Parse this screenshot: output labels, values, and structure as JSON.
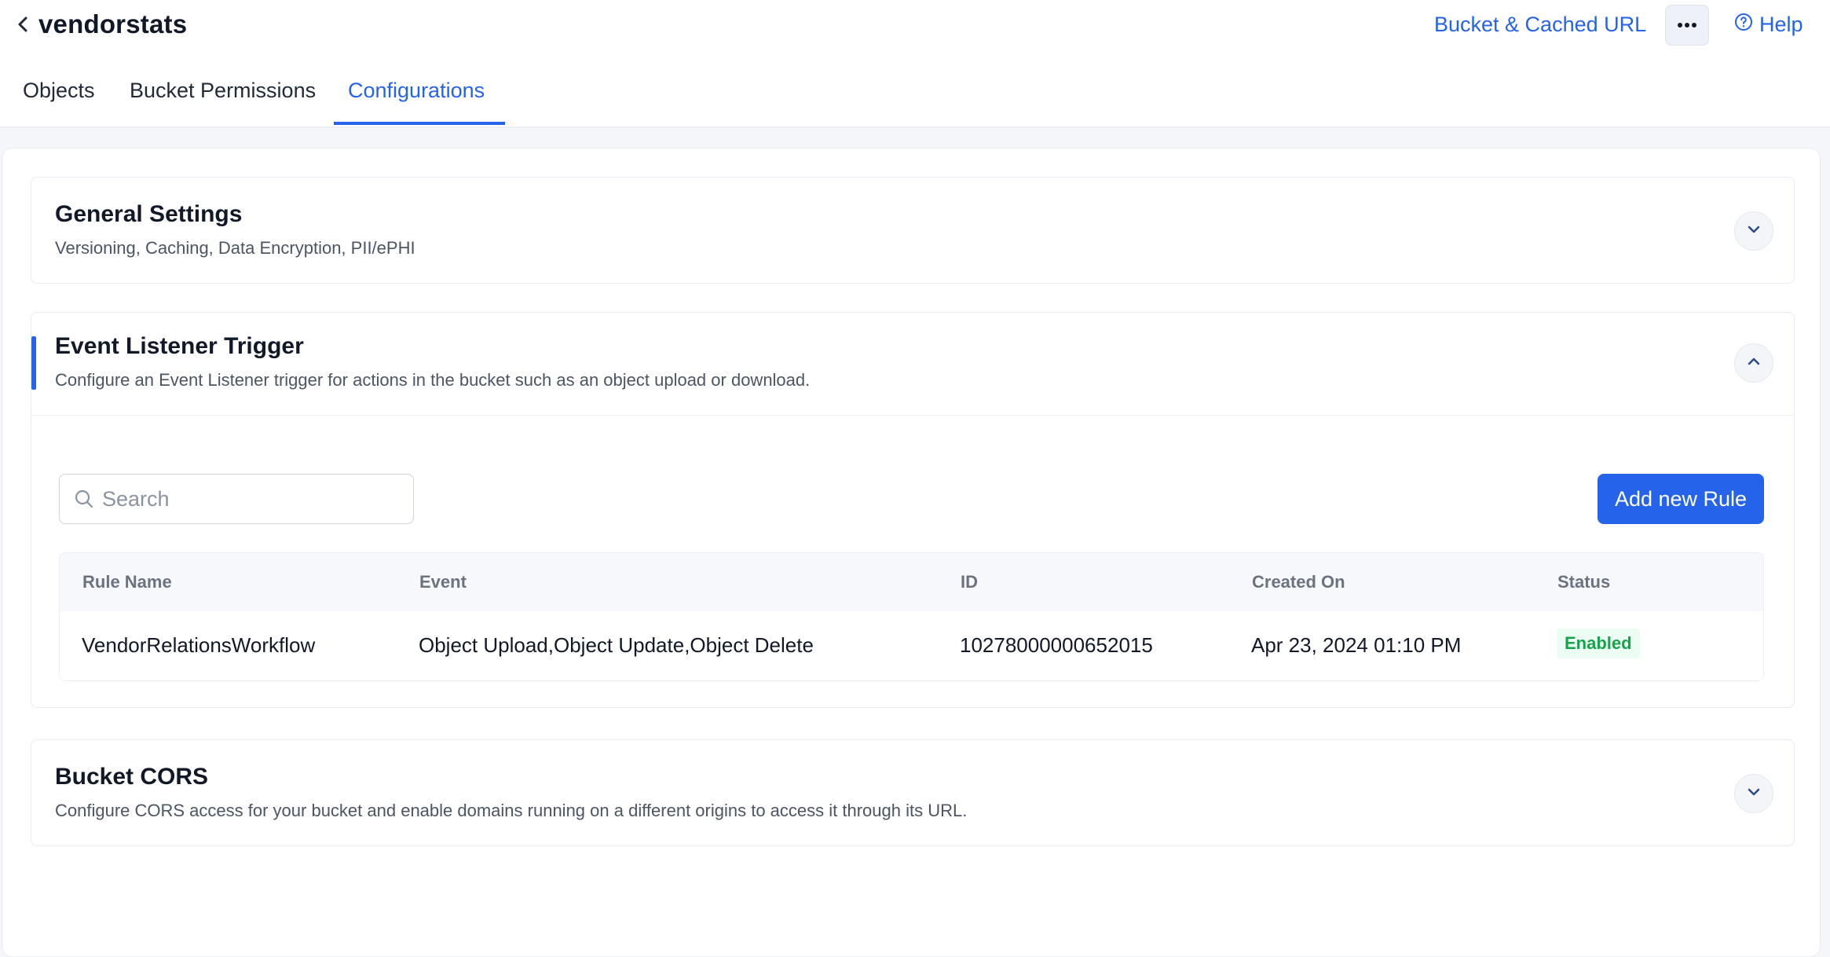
{
  "header": {
    "title": "vendorstats",
    "bucket_link": "Bucket & Cached URL",
    "help_label": "Help"
  },
  "tabs": [
    {
      "label": "Objects",
      "active": false
    },
    {
      "label": "Bucket Permissions",
      "active": false
    },
    {
      "label": "Configurations",
      "active": true
    }
  ],
  "sections": {
    "general": {
      "title": "General Settings",
      "subtitle": "Versioning, Caching, Data Encryption, PII/ePHI",
      "expanded": false
    },
    "event_listener": {
      "title": "Event Listener Trigger",
      "subtitle": "Configure an Event Listener trigger for actions in the bucket such as an object upload or download.",
      "expanded": true,
      "search_placeholder": "Search",
      "search_value": "",
      "add_button": "Add new Rule",
      "columns": [
        "Rule Name",
        "Event",
        "ID",
        "Created On",
        "Status"
      ],
      "rows": [
        {
          "rule_name": "VendorRelationsWorkflow",
          "event": "Object Upload,Object Update,Object Delete",
          "id": "10278000000652015",
          "created_on": "Apr 23, 2024 01:10 PM",
          "status": "Enabled"
        }
      ]
    },
    "cors": {
      "title": "Bucket CORS",
      "subtitle": "Configure CORS access for your bucket and enable domains running on a different origins to access it through its URL.",
      "expanded": false
    }
  },
  "colors": {
    "accent": "#2563eb",
    "status_enabled_text": "#16a34a",
    "status_enabled_bg": "#ecfdf3"
  },
  "icons": [
    "chevron-left-icon",
    "more-horizontal-icon",
    "help-circle-icon",
    "chevron-down-icon",
    "chevron-up-icon",
    "search-icon"
  ]
}
